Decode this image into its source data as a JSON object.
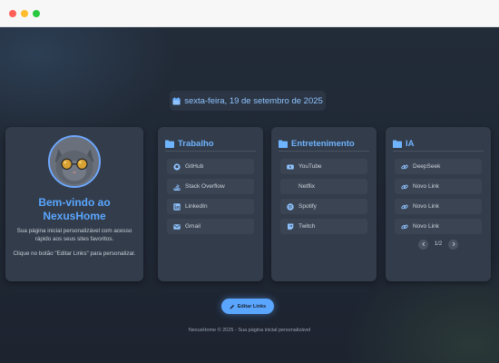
{
  "date": "sexta-feira, 19 de setembro de 2025",
  "welcome": {
    "title": "Bem-vindo ao NexusHome",
    "text1": "Sua página inicial personalizável com acesso rápido aos seus sites favoritos.",
    "text2": "Clique no botão \"Editar Links\" para personalizar."
  },
  "cards": [
    {
      "title": "Trabalho",
      "links": [
        {
          "label": "GitHub",
          "icon": "github-icon"
        },
        {
          "label": "Stack Overflow",
          "icon": "stack-overflow-icon"
        },
        {
          "label": "LinkedIn",
          "icon": "linkedin-icon"
        },
        {
          "label": "Gmail",
          "icon": "mail-icon"
        }
      ]
    },
    {
      "title": "Entretenimento",
      "links": [
        {
          "label": "YouTube",
          "icon": "youtube-icon"
        },
        {
          "label": "Netflix",
          "icon": "netflix-icon"
        },
        {
          "label": "Spotify",
          "icon": "spotify-icon"
        },
        {
          "label": "Twitch",
          "icon": "twitch-icon"
        }
      ]
    },
    {
      "title": "IA",
      "links": [
        {
          "label": "DeepSeek",
          "icon": "link-icon"
        },
        {
          "label": "Novo Link",
          "icon": "link-icon"
        },
        {
          "label": "Novo Link",
          "icon": "link-icon"
        },
        {
          "label": "Novo Link",
          "icon": "link-icon"
        }
      ],
      "pagination": "1/2"
    }
  ],
  "edit_button": "Editar Links",
  "footer": "NexusHome © 2025 - Sua página inicial personalizável",
  "colors": {
    "accent": "#5aa6ff",
    "card": "#333c4a",
    "link_bg": "#3b4453",
    "background": "#1c2330"
  }
}
